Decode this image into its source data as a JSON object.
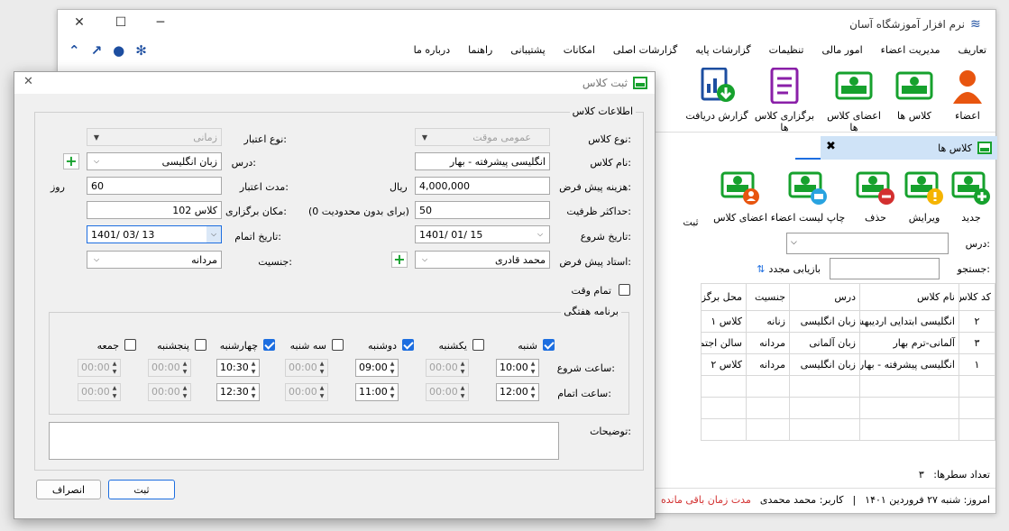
{
  "app": {
    "title": "نرم افزار آموزشگاه آسان"
  },
  "menu": [
    "تعاریف",
    "مدیریت اعضاء",
    "امور مالی",
    "تنظیمات",
    "گزارشات پایه",
    "گزارشات اصلی",
    "امکانات",
    "پشتیبانی",
    "راهنما",
    "درباره ما"
  ],
  "ribbon": {
    "members": "اعضاء",
    "classes": "کلاس ها",
    "class_members": "اعضای کلاس ها",
    "hold_classes": "برگزاری کلاس ها",
    "receipt_report": "گزارش دریافت"
  },
  "tab": {
    "label": "کلاس ها"
  },
  "inner": {
    "btn_new": "جدید",
    "btn_edit": "ویرایش",
    "btn_delete": "حذف",
    "btn_print": "چاپ لیست اعضاء",
    "btn_members": "اعضای کلاس",
    "btn_save": "ثبت",
    "lesson_label": "درس:",
    "search_label": "جستجو:",
    "reload_label": "بازیابی مجدد",
    "columns": [
      "کد کلاس",
      "نام کلاس",
      "درس",
      "جنسیت",
      "محل برگزاری"
    ],
    "rows": [
      [
        "۲",
        "انگلیسی ابتدایی اردیبهشت",
        "زبان انگلیسی",
        "زنانه",
        "کلاس ۱"
      ],
      [
        "۳",
        "آلمانی-ترم بهار",
        "زبان آلمانی",
        "مردانه",
        "سالن اجتماعات"
      ],
      [
        "۱",
        "انگلیسی پیشرفته - بهار",
        "زبان انگلیسی",
        "مردانه",
        "کلاس ۲"
      ]
    ],
    "row_count_label": "تعداد سطرها:",
    "row_count": "۳"
  },
  "status": {
    "today": "امروز: شنبه ۲۷ فروردین ۱۴۰۱",
    "user": "کاربر: محمد محمدی",
    "remain": "مدت زمان باقی مانده"
  },
  "dialog": {
    "title": "ثبت کلاس",
    "group_info": "اطلاعات کلاس",
    "class_type_label": "نوع کلاس:",
    "class_type_value": "عمومی موقت",
    "credit_type_label": "نوع اعتبار:",
    "credit_type_value": "زمانی",
    "class_name_label": "نام کلاس:",
    "class_name_value": "انگلیسی پیشرفته - بهار",
    "lesson_label": "درس:",
    "lesson_value": "زبان انگلیسی",
    "fee_label": "هزینه پیش فرض:",
    "fee_value": "4,000,000",
    "fee_unit": "ریال",
    "validity_label": "مدت اعتبار:",
    "validity_value": "60",
    "validity_unit": "روز",
    "capacity_label": "حداکثر ظرفیت:",
    "capacity_value": "50",
    "capacity_hint": "(0 برای بدون محدودیت)",
    "place_label": "مکان برگزاری:",
    "place_value": "کلاس 102",
    "start_date_label": "تاریخ شروع:",
    "start_date_value": "1401/ 01/ 15",
    "end_date_label": "تاریخ اتمام:",
    "end_date_value": "1401/ 03/ 13",
    "teacher_label": "استاد پیش فرض:",
    "teacher_value": "محمد قادری",
    "gender_label": "جنسیت:",
    "gender_value": "مردانه",
    "fulltime_label": "تمام وقت",
    "group_week": "برنامه هفتگی",
    "start_time_label": "ساعت شروع:",
    "end_time_label": "ساعت اتمام:",
    "days": [
      {
        "name": "شنبه",
        "checked": true,
        "start": "10:00",
        "end": "12:00"
      },
      {
        "name": "یکشنبه",
        "checked": false,
        "start": "00:00",
        "end": "00:00"
      },
      {
        "name": "دوشنبه",
        "checked": true,
        "start": "09:00",
        "end": "11:00"
      },
      {
        "name": "سه شنبه",
        "checked": false,
        "start": "00:00",
        "end": "00:00"
      },
      {
        "name": "چهارشنبه",
        "checked": true,
        "start": "10:30",
        "end": "12:30"
      },
      {
        "name": "پنجشنبه",
        "checked": false,
        "start": "00:00",
        "end": "00:00"
      },
      {
        "name": "جمعه",
        "checked": false,
        "start": "00:00",
        "end": "00:00"
      }
    ],
    "desc_label": "توضیحات:",
    "save_btn": "ثبت",
    "cancel_btn": "انصراف"
  },
  "colors": {
    "accent": "#1d6ee0",
    "green": "#16a12d",
    "purple": "#8a1fa8",
    "orange": "#e8550f"
  }
}
